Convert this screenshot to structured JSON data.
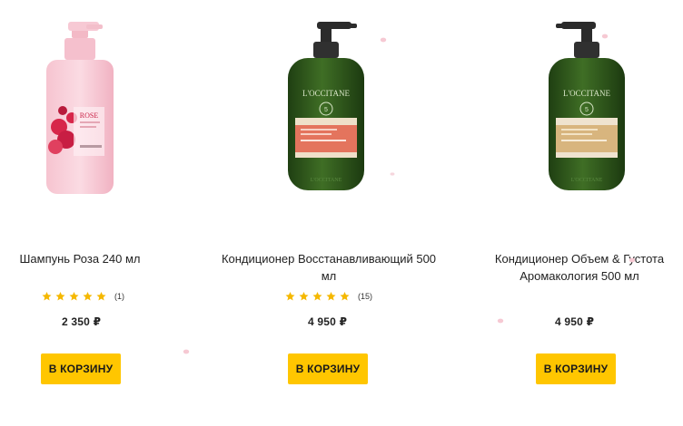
{
  "products": [
    {
      "name": "Шампунь Роза 240 мл",
      "rating_stars": 5,
      "reviews": "(1)",
      "price": "2 350 ₽",
      "button_label": "В КОРЗИНУ",
      "image": "rose-shampoo-bottle"
    },
    {
      "name": "Кондиционер Восстанавливающий 500 мл",
      "rating_stars": 5,
      "reviews": "(15)",
      "price": "4 950 ₽",
      "button_label": "В КОРЗИНУ",
      "image": "green-conditioner-bottle-red-label"
    },
    {
      "name": "Кондиционер Объем & Густота Аромакология 500 мл",
      "price": "4 950 ₽",
      "button_label": "В КОРЗИНУ",
      "image": "green-conditioner-bottle-beige-label"
    }
  ],
  "colors": {
    "button": "#ffc600",
    "star": "#f5b800",
    "bottle_green": "#2f5a1c",
    "rose_pink": "#f5b5c4"
  },
  "icons": [
    "star-icon",
    "petal-icon"
  ]
}
